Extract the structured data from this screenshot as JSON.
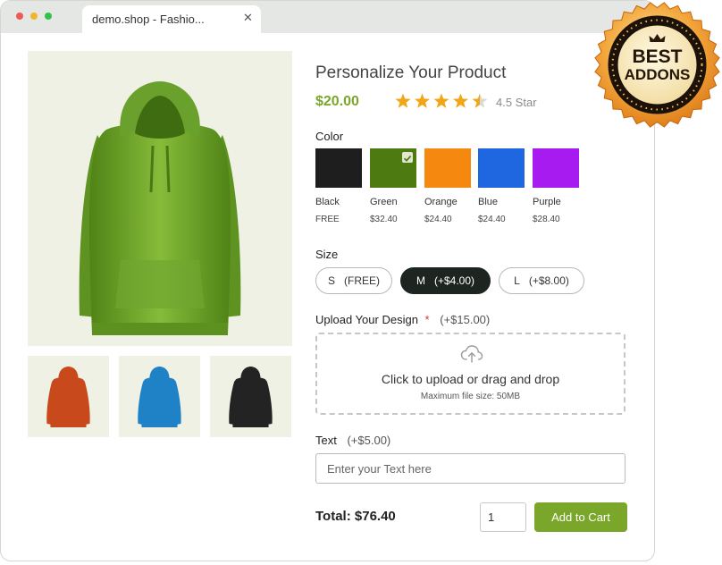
{
  "window": {
    "tab_title": "demo.shop - Fashio...",
    "tab_close": "✕"
  },
  "product": {
    "title": "Personalize Your Product",
    "price": "$20.00",
    "rating": 4.5,
    "rating_text": "4.5 Star"
  },
  "color": {
    "label": "Color",
    "options": [
      {
        "name": "Black",
        "price": "FREE",
        "hex": "#1e1e1e"
      },
      {
        "name": "Green",
        "price": "$32.40",
        "hex": "#4e7a12",
        "selected": true
      },
      {
        "name": "Orange",
        "price": "$24.40",
        "hex": "#f5890f"
      },
      {
        "name": "Blue",
        "price": "$24.40",
        "hex": "#1f67e0"
      },
      {
        "name": "Purple",
        "price": "$28.40",
        "hex": "#a81bf0"
      }
    ]
  },
  "size": {
    "label": "Size",
    "options": [
      {
        "size": "S",
        "price": "(FREE)"
      },
      {
        "size": "M",
        "price": "(+$4.00)",
        "selected": true
      },
      {
        "size": "L",
        "price": "(+$8.00)"
      }
    ]
  },
  "upload": {
    "label": "Upload Your Design",
    "required_mark": "*",
    "price": "(+$15.00)",
    "title": "Click to upload or drag and drop",
    "subtitle": "Maximum file size: 50MB"
  },
  "text_field": {
    "label": "Text",
    "price": "(+$5.00)",
    "placeholder": "Enter your Text here"
  },
  "cart": {
    "total": "Total: $76.40",
    "quantity": "1",
    "button": "Add to Cart"
  },
  "badge": {
    "line1": "BEST",
    "line2": "ADDONS"
  },
  "gallery": {
    "main_color": "#6fa12a",
    "thumbnails": [
      {
        "color": "#c84a1c"
      },
      {
        "color": "#1f82c6"
      },
      {
        "color": "#222222"
      }
    ]
  },
  "colors": {
    "accent": "#7aa62a",
    "selected_dark": "#1c2520",
    "image_bg": "#eff1e4"
  }
}
